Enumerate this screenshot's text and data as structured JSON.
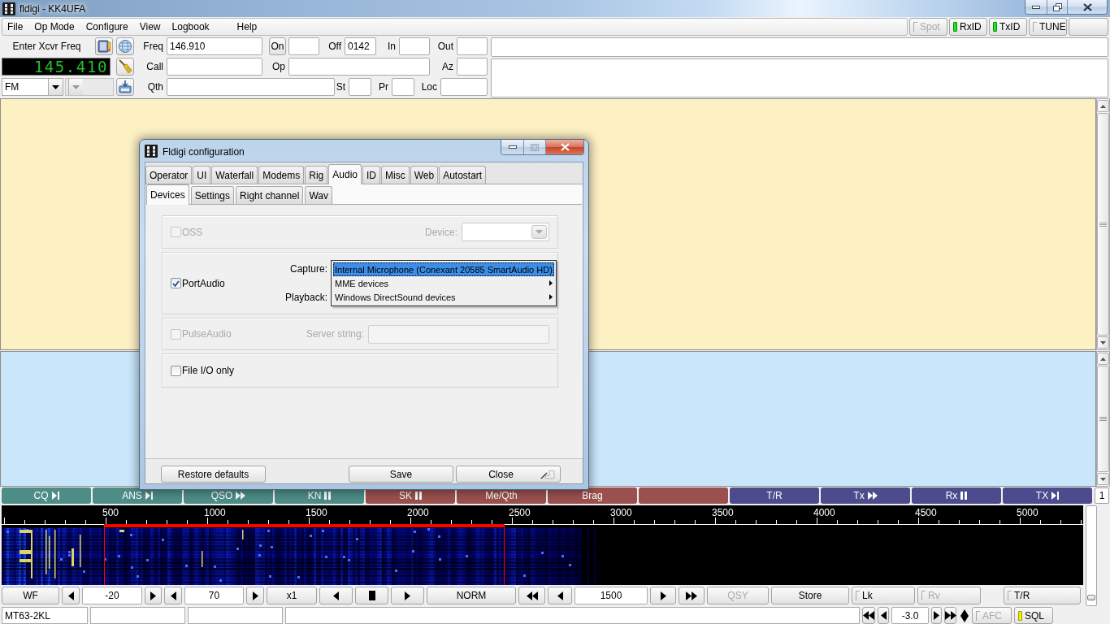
{
  "window": {
    "title": "fldigi - KK4UFA"
  },
  "menu": [
    {
      "label": "File"
    },
    {
      "label": "Op Mode"
    },
    {
      "label": "Configure"
    },
    {
      "label": "View"
    },
    {
      "label": "Logbook"
    },
    {
      "label": "Help"
    }
  ],
  "toggles": [
    {
      "label": "Spot",
      "on": false,
      "disabled": true
    },
    {
      "label": "RxID",
      "on": true,
      "disabled": false
    },
    {
      "label": "TxID",
      "on": true,
      "disabled": false
    },
    {
      "label": "TUNE",
      "on": false,
      "disabled": false
    }
  ],
  "transceiver": {
    "label": "Enter Xcvr Freq",
    "frequency": "145.410",
    "mode": "FM",
    "submode": {
      "disabled": true
    }
  },
  "log": {
    "freq": {
      "label": "Freq",
      "value": "146.910"
    },
    "on": {
      "label": "On"
    },
    "off": {
      "label": "Off",
      "value": "0142"
    },
    "in": {
      "label": "In"
    },
    "out": {
      "label": "Out"
    },
    "call": {
      "label": "Call"
    },
    "op": {
      "label": "Op"
    },
    "az": {
      "label": "Az"
    },
    "qth": {
      "label": "Qth"
    },
    "st": {
      "label": "St"
    },
    "pr": {
      "label": "Pr"
    },
    "loc": {
      "label": "Loc"
    }
  },
  "macros": [
    {
      "label": "CQ",
      "kind": "end",
      "color": "#4d8c87"
    },
    {
      "label": "ANS",
      "kind": "end",
      "color": "#4d8c87"
    },
    {
      "label": "QSO",
      "kind": "forward",
      "color": "#4d8c87"
    },
    {
      "label": "KN",
      "kind": "pause",
      "color": "#4d8c87"
    },
    {
      "label": "SK",
      "kind": "pause",
      "color": "#9a504e"
    },
    {
      "label": "Me/Qth",
      "kind": "plain",
      "color": "#9a504e"
    },
    {
      "label": "Brag",
      "kind": "plain",
      "color": "#9a504e"
    },
    {
      "kind": "plain",
      "color": "#9a504e"
    },
    {
      "label": "T/R",
      "kind": "plain",
      "color": "#4b4b8e"
    },
    {
      "label": "Tx",
      "kind": "forward",
      "color": "#4b4b8e"
    },
    {
      "label": "Rx",
      "kind": "pause",
      "color": "#4b4b8e"
    },
    {
      "label": "TX",
      "kind": "end",
      "color": "#4b4b8e"
    }
  ],
  "macro_page": "1",
  "waterfall": {
    "scale_labels": [
      "500",
      "1000",
      "1500",
      "2000",
      "2500",
      "3000",
      "3500",
      "4000",
      "4500",
      "5000"
    ]
  },
  "controls": [
    {
      "kind": "button",
      "label": "WF",
      "disabled": false
    },
    {
      "kind": "left",
      "disabled": false
    },
    {
      "kind": "field",
      "value": "-20",
      "disabled": false
    },
    {
      "kind": "right",
      "disabled": false
    },
    {
      "kind": "left",
      "disabled": false
    },
    {
      "kind": "field",
      "value": "70",
      "disabled": false
    },
    {
      "kind": "right",
      "disabled": false
    },
    {
      "kind": "button",
      "label": "x1",
      "disabled": false
    },
    {
      "kind": "left",
      "disabled": false
    },
    {
      "kind": "stop",
      "disabled": false
    },
    {
      "kind": "right",
      "disabled": false
    },
    {
      "kind": "button",
      "label": "NORM",
      "disabled": false
    },
    {
      "kind": "rewind",
      "disabled": false
    },
    {
      "kind": "left",
      "disabled": false
    },
    {
      "kind": "field",
      "value": "1500",
      "disabled": false
    },
    {
      "kind": "right",
      "disabled": false
    },
    {
      "kind": "forward",
      "disabled": false
    },
    {
      "kind": "button",
      "label": "QSY",
      "disabled": true
    },
    {
      "kind": "button",
      "label": "Store",
      "disabled": false
    },
    {
      "kind": "toggle",
      "label": "Lk",
      "on": false,
      "disabled": false
    },
    {
      "kind": "toggle",
      "label": "Rv",
      "on": false,
      "disabled": true
    },
    {
      "kind": "toggle",
      "label": "T/R",
      "on": false,
      "disabled": false
    }
  ],
  "slider": {
    "level": 0.05
  },
  "status_bar": {
    "mode": "MT63-2KL",
    "controls": [
      {
        "kind": "rewind",
        "disabled": false
      },
      {
        "kind": "left",
        "disabled": false
      },
      {
        "kind": "field",
        "value": "-3.0",
        "disabled": false
      },
      {
        "kind": "right",
        "disabled": false
      },
      {
        "kind": "forward",
        "disabled": false
      },
      {
        "kind": "diamond",
        "disabled": false
      },
      {
        "kind": "toggle",
        "label": "AFC",
        "on": false,
        "disabled": true
      },
      {
        "kind": "toggle",
        "label": "SQL",
        "on": true,
        "disabled": false
      }
    ]
  },
  "config_dialog": {
    "title": "Fldigi configuration",
    "tabs": [
      {
        "label": "Operator",
        "selected": false
      },
      {
        "label": "UI",
        "selected": false
      },
      {
        "label": "Waterfall",
        "selected": false
      },
      {
        "label": "Modems",
        "selected": false
      },
      {
        "label": "Rig",
        "selected": false
      },
      {
        "label": "Audio",
        "selected": true
      },
      {
        "label": "ID",
        "selected": false
      },
      {
        "label": "Misc",
        "selected": false
      },
      {
        "label": "Web",
        "selected": false
      },
      {
        "label": "Autostart",
        "selected": false
      }
    ],
    "subtabs": [
      {
        "label": "Devices",
        "selected": true
      },
      {
        "label": "Settings",
        "selected": false
      },
      {
        "label": "Right channel",
        "selected": false
      },
      {
        "label": "Wav",
        "selected": false
      }
    ],
    "oss": {
      "label": "OSS",
      "checked": false,
      "disabled": true,
      "device_label": "Device:"
    },
    "portaudio": {
      "label": "PortAudio",
      "checked": true,
      "disabled": false,
      "capture_label": "Capture:",
      "playback_label": "Playback:",
      "menu": [
        {
          "label": "Internal Microphone (Conexant 20585 SmartAudio HD)",
          "selected": true,
          "submenu": false
        },
        {
          "label": "MME devices",
          "selected": false,
          "submenu": true
        },
        {
          "label": "Windows DirectSound devices",
          "selected": false,
          "submenu": true
        }
      ]
    },
    "pulseaudio": {
      "label": "PulseAudio",
      "checked": false,
      "disabled": true,
      "server_label": "Server string:"
    },
    "file_io": {
      "label": "File I/O only",
      "checked": false,
      "disabled": false
    },
    "buttons": [
      {
        "label": "Restore defaults",
        "kind": "plain"
      },
      {
        "label": "Save",
        "kind": "plain"
      },
      {
        "label": "Close",
        "kind": "return"
      }
    ]
  }
}
